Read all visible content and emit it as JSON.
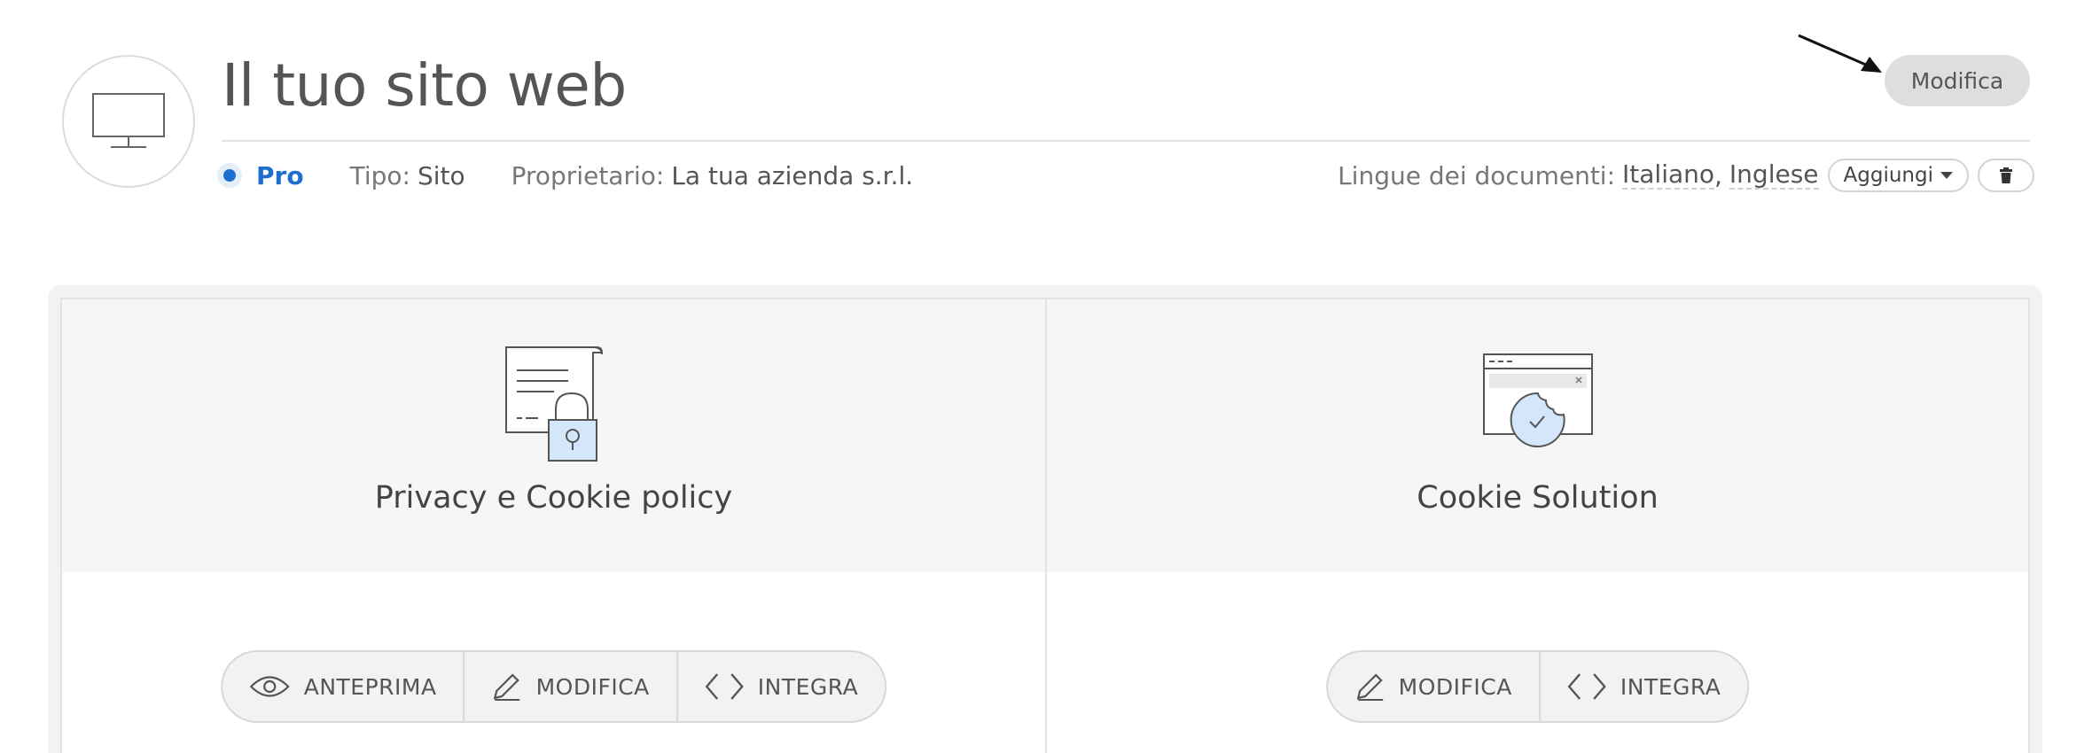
{
  "header": {
    "title": "Il tuo sito web",
    "edit_label": "Modifica",
    "plan": "Pro",
    "type_key": "Tipo:",
    "type_value": "Sito",
    "owner_key": "Proprietario:",
    "owner_value": "La tua azienda s.r.l.",
    "languages_key": "Lingue dei documenti:",
    "languages": [
      "Italiano",
      "Inglese"
    ],
    "add_label": "Aggiungi",
    "accent_color": "#1c6fd1"
  },
  "cards": [
    {
      "title": "Privacy e Cookie policy",
      "icon": "document-lock-icon",
      "actions": [
        {
          "label": "ANTEPRIMA",
          "icon": "eye-icon"
        },
        {
          "label": "MODIFICA",
          "icon": "pencil-icon"
        },
        {
          "label": "INTEGRA",
          "icon": "code-icon"
        }
      ]
    },
    {
      "title": "Cookie Solution",
      "icon": "browser-cookie-icon",
      "actions": [
        {
          "label": "MODIFICA",
          "icon": "pencil-icon"
        },
        {
          "label": "INTEGRA",
          "icon": "code-icon"
        }
      ]
    }
  ]
}
